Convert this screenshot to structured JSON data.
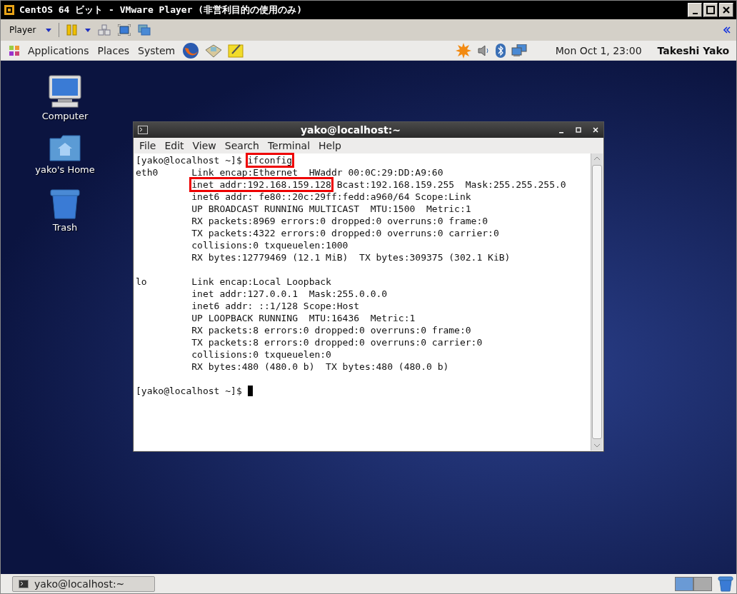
{
  "window": {
    "title": "CentOS 64 ビット - VMware Player (非営利目的の使用のみ)"
  },
  "toolbar": {
    "player_menu": "Player"
  },
  "panel": {
    "menus": [
      "Applications",
      "Places",
      "System"
    ],
    "clock": "Mon Oct  1, 23:00",
    "user": "Takeshi Yako"
  },
  "desktop_icons": [
    {
      "kind": "computer",
      "label": "Computer"
    },
    {
      "kind": "home",
      "label": "yako's Home"
    },
    {
      "kind": "trash",
      "label": "Trash"
    }
  ],
  "terminal": {
    "title": "yako@localhost:~",
    "menu": [
      "File",
      "Edit",
      "View",
      "Search",
      "Terminal",
      "Help"
    ],
    "lines": [
      {
        "kind": "command",
        "prompt": "[yako@localhost ~]$",
        "command": "ifconfig"
      },
      {
        "kind": "text",
        "text": "eth0      Link encap:Ethernet  HWaddr 00:0C:29:DD:A9:60"
      },
      {
        "kind": "marked",
        "marked": "inet addr:192.168.159.128",
        "after": "Bcast:192.168.159.255  Mask:255.255.255.0"
      },
      {
        "kind": "text",
        "text": "          inet6 addr: fe80::20c:29ff:fedd:a960/64 Scope:Link"
      },
      {
        "kind": "text",
        "text": "          UP BROADCAST RUNNING MULTICAST  MTU:1500  Metric:1"
      },
      {
        "kind": "text",
        "text": "          RX packets:8969 errors:0 dropped:0 overruns:0 frame:0"
      },
      {
        "kind": "text",
        "text": "          TX packets:4322 errors:0 dropped:0 overruns:0 carrier:0"
      },
      {
        "kind": "text",
        "text": "          collisions:0 txqueuelen:1000"
      },
      {
        "kind": "text",
        "text": "          RX bytes:12779469 (12.1 MiB)  TX bytes:309375 (302.1 KiB)"
      },
      {
        "kind": "blank"
      },
      {
        "kind": "text",
        "text": "lo        Link encap:Local Loopback"
      },
      {
        "kind": "text",
        "text": "          inet addr:127.0.0.1  Mask:255.0.0.0"
      },
      {
        "kind": "text",
        "text": "          inet6 addr: ::1/128 Scope:Host"
      },
      {
        "kind": "text",
        "text": "          UP LOOPBACK RUNNING  MTU:16436  Metric:1"
      },
      {
        "kind": "text",
        "text": "          RX packets:8 errors:0 dropped:0 overruns:0 frame:0"
      },
      {
        "kind": "text",
        "text": "          TX packets:8 errors:0 dropped:0 overruns:0 carrier:0"
      },
      {
        "kind": "text",
        "text": "          collisions:0 txqueuelen:0"
      },
      {
        "kind": "text",
        "text": "          RX bytes:480 (480.0 b)  TX bytes:480 (480.0 b)"
      },
      {
        "kind": "blank"
      },
      {
        "kind": "prompt",
        "prompt": "[yako@localhost ~]$",
        "cursor": true
      }
    ]
  },
  "taskbar": {
    "items": [
      {
        "label": "yako@localhost:~",
        "selected": false
      }
    ],
    "workspaces": [
      {
        "selected": true
      },
      {
        "selected": false
      }
    ]
  }
}
